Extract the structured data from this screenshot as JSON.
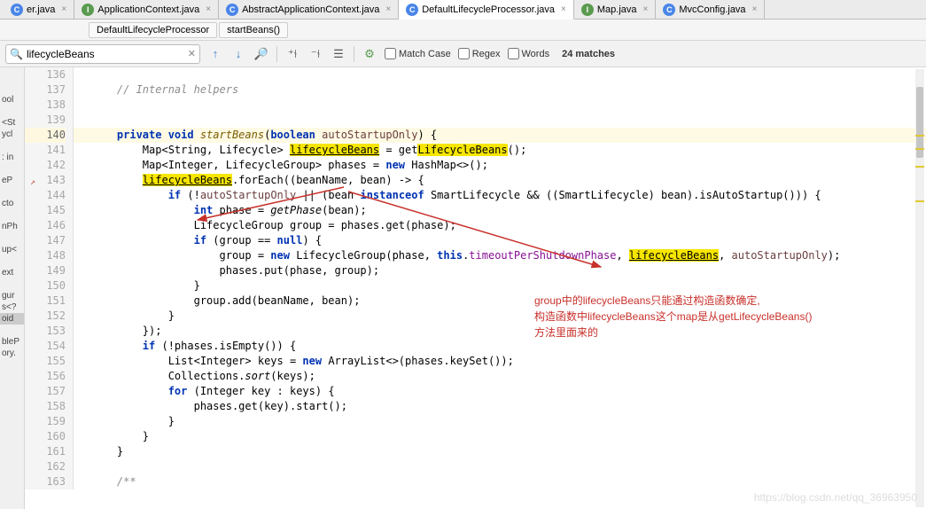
{
  "tabs": [
    {
      "icon": "C",
      "cls": "ico-c",
      "label": "er.java",
      "active": false
    },
    {
      "icon": "I",
      "cls": "ico-i",
      "label": "ApplicationContext.java",
      "active": false
    },
    {
      "icon": "C",
      "cls": "ico-c",
      "label": "AbstractApplicationContext.java",
      "active": false
    },
    {
      "icon": "C",
      "cls": "ico-c",
      "label": "DefaultLifecycleProcessor.java",
      "active": true
    },
    {
      "icon": "I",
      "cls": "ico-i",
      "label": "Map.java",
      "active": false
    },
    {
      "icon": "C",
      "cls": "ico-c",
      "label": "MvcConfig.java",
      "active": false
    }
  ],
  "breadcrumb": {
    "items": [
      "DefaultLifecycleProcessor",
      "startBeans()"
    ]
  },
  "search": {
    "placeholder": "",
    "value": "lifecycleBeans",
    "matchCase": "Match Case",
    "regex": "Regex",
    "words": "Words",
    "matches": "24 matches"
  },
  "leftpane": [
    "",
    "",
    "ool",
    "",
    "<St",
    "ycl",
    "",
    ": in",
    "",
    "eP",
    "",
    "cto",
    "",
    "nPh",
    "",
    "up<",
    "",
    "ext",
    "",
    "gur",
    "s<?",
    "oid",
    "",
    "bleP",
    "ory.",
    ""
  ],
  "leftpane_hl_index": 21,
  "gutter": {
    "start": 136,
    "end": 163,
    "active": 140,
    "marker": 143
  },
  "code_lines": [
    {
      "n": 136,
      "segs": []
    },
    {
      "n": 137,
      "segs": [
        {
          "t": "    ",
          "c": ""
        },
        {
          "t": "// Internal helpers",
          "c": "cmt"
        }
      ]
    },
    {
      "n": 138,
      "segs": []
    },
    {
      "n": 139,
      "segs": []
    },
    {
      "n": 140,
      "active": true,
      "segs": [
        {
          "t": "    ",
          "c": ""
        },
        {
          "t": "private void ",
          "c": "kw"
        },
        {
          "t": "startBeans",
          "c": "fn"
        },
        {
          "t": "(",
          "c": ""
        },
        {
          "t": "boolean ",
          "c": "kw"
        },
        {
          "t": "autoStartupOnly",
          "c": "param"
        },
        {
          "t": ") {",
          "c": ""
        }
      ]
    },
    {
      "n": 141,
      "segs": [
        {
          "t": "        Map<String, Lifecycle> ",
          "c": ""
        },
        {
          "t": "lifecycleBeans",
          "c": "hl underline"
        },
        {
          "t": " = get",
          "c": ""
        },
        {
          "t": "LifecycleBeans",
          "c": "hl"
        },
        {
          "t": "();",
          "c": ""
        }
      ]
    },
    {
      "n": 142,
      "segs": [
        {
          "t": "        Map<Integer, LifecycleGroup> phases = ",
          "c": ""
        },
        {
          "t": "new ",
          "c": "kw"
        },
        {
          "t": "HashMap<>();",
          "c": ""
        }
      ]
    },
    {
      "n": 143,
      "segs": [
        {
          "t": "        ",
          "c": ""
        },
        {
          "t": "lifecycleBeans",
          "c": "hl underline"
        },
        {
          "t": ".forEach((beanName, bean) -> {",
          "c": ""
        }
      ]
    },
    {
      "n": 144,
      "segs": [
        {
          "t": "            ",
          "c": ""
        },
        {
          "t": "if ",
          "c": "kw"
        },
        {
          "t": "(!",
          "c": ""
        },
        {
          "t": "autoStartupOnly",
          "c": "param"
        },
        {
          "t": " || (bean ",
          "c": ""
        },
        {
          "t": "instanceof ",
          "c": "kw"
        },
        {
          "t": "SmartLifecycle && ((SmartLifecycle) bean).isAutoStartup())) {",
          "c": ""
        }
      ]
    },
    {
      "n": 145,
      "segs": [
        {
          "t": "                ",
          "c": ""
        },
        {
          "t": "int ",
          "c": "kw"
        },
        {
          "t": "phase = ",
          "c": ""
        },
        {
          "t": "getPhase",
          "c": "it"
        },
        {
          "t": "(bean);",
          "c": ""
        }
      ]
    },
    {
      "n": 146,
      "segs": [
        {
          "t": "                LifecycleGroup group = phases.get(phase);",
          "c": ""
        }
      ]
    },
    {
      "n": 147,
      "segs": [
        {
          "t": "                ",
          "c": ""
        },
        {
          "t": "if ",
          "c": "kw"
        },
        {
          "t": "(group == ",
          "c": ""
        },
        {
          "t": "null",
          "c": "kw"
        },
        {
          "t": ") {",
          "c": ""
        }
      ]
    },
    {
      "n": 148,
      "segs": [
        {
          "t": "                    group = ",
          "c": ""
        },
        {
          "t": "new ",
          "c": "kw"
        },
        {
          "t": "LifecycleGroup(phase, ",
          "c": ""
        },
        {
          "t": "this",
          "c": "kw"
        },
        {
          "t": ".",
          "c": ""
        },
        {
          "t": "timeoutPerShutdownPhase",
          "c": "fld"
        },
        {
          "t": ", ",
          "c": ""
        },
        {
          "t": "lifecycleBeans",
          "c": "hl underline"
        },
        {
          "t": ", ",
          "c": ""
        },
        {
          "t": "autoStartupOnly",
          "c": "param"
        },
        {
          "t": ");",
          "c": ""
        }
      ]
    },
    {
      "n": 149,
      "segs": [
        {
          "t": "                    phases.put(phase, group);",
          "c": ""
        }
      ]
    },
    {
      "n": 150,
      "segs": [
        {
          "t": "                }",
          "c": ""
        }
      ]
    },
    {
      "n": 151,
      "segs": [
        {
          "t": "                group.add(beanName, bean);",
          "c": ""
        }
      ]
    },
    {
      "n": 152,
      "segs": [
        {
          "t": "            }",
          "c": ""
        }
      ]
    },
    {
      "n": 153,
      "segs": [
        {
          "t": "        });",
          "c": ""
        }
      ]
    },
    {
      "n": 154,
      "segs": [
        {
          "t": "        ",
          "c": ""
        },
        {
          "t": "if ",
          "c": "kw"
        },
        {
          "t": "(!phases.isEmpty()) {",
          "c": ""
        }
      ]
    },
    {
      "n": 155,
      "segs": [
        {
          "t": "            List<Integer> keys = ",
          "c": ""
        },
        {
          "t": "new ",
          "c": "kw"
        },
        {
          "t": "ArrayList<>(phases.keySet());",
          "c": ""
        }
      ]
    },
    {
      "n": 156,
      "segs": [
        {
          "t": "            Collections.",
          "c": ""
        },
        {
          "t": "sort",
          "c": "it"
        },
        {
          "t": "(keys);",
          "c": ""
        }
      ]
    },
    {
      "n": 157,
      "segs": [
        {
          "t": "            ",
          "c": ""
        },
        {
          "t": "for ",
          "c": "kw"
        },
        {
          "t": "(Integer key : keys) {",
          "c": ""
        }
      ]
    },
    {
      "n": 158,
      "segs": [
        {
          "t": "                phases.get(key).start();",
          "c": ""
        }
      ]
    },
    {
      "n": 159,
      "segs": [
        {
          "t": "            }",
          "c": ""
        }
      ]
    },
    {
      "n": 160,
      "segs": [
        {
          "t": "        }",
          "c": ""
        }
      ]
    },
    {
      "n": 161,
      "segs": [
        {
          "t": "    }",
          "c": ""
        }
      ]
    },
    {
      "n": 162,
      "segs": []
    },
    {
      "n": 163,
      "segs": [
        {
          "t": "    ",
          "c": ""
        },
        {
          "t": "/**",
          "c": "cmt"
        }
      ]
    }
  ],
  "annotation": {
    "line1": "group中的lifecycleBeans只能通过构造函数确定,",
    "line2": "构造函数中lifecycleBeans这个map是从getLifecycleBeans()",
    "line3": "方法里面来的"
  },
  "watermark": "https://blog.csdn.net/qq_36963950"
}
